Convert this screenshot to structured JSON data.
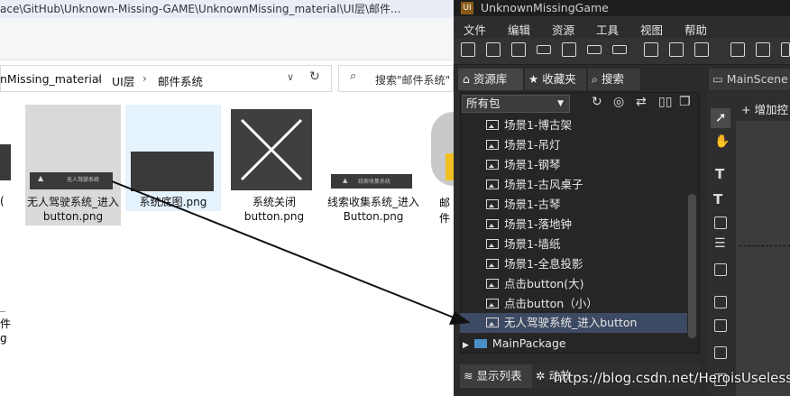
{
  "explorer": {
    "title_path": "ace\\GitHub\\Unknown-Missing-GAME\\UnknownMissing_material\\UI层\\邮件...",
    "breadcrumb": [
      "nMissing_material",
      "UI层",
      "邮件系统"
    ],
    "refresh_icon": "refresh-icon",
    "search_placeholder": "搜索\"邮件系统\"",
    "files": [
      {
        "name": "无人驾驶系统_进入button.png",
        "thumb_text": "无人驾驶系统"
      },
      {
        "name": "系统底图.png",
        "thumb_text": ""
      },
      {
        "name": "系统关闭button.png",
        "thumb_text": ""
      },
      {
        "name": "线索收集系统_进入Button.png",
        "thumb_text": "线索收集系统"
      },
      {
        "name": "邮件",
        "thumb_text": ""
      }
    ],
    "left_fragment_top": "(",
    "left_fragment_bottom_1": "件",
    "left_fragment_bottom_2": "g"
  },
  "editor": {
    "title": "UnknownMissingGame",
    "menu": [
      "文件",
      "编辑",
      "资源",
      "工具",
      "视图",
      "帮助"
    ],
    "tabs": {
      "library": "资源库",
      "favorites": "收藏夹",
      "search": "搜索"
    },
    "scene_tab": "MainScene",
    "add_button": "+ 增加控",
    "package_select": "所有包",
    "items": [
      "场景1-博古架",
      "场景1-吊灯",
      "场景1-钢琴",
      "场景1-古风桌子",
      "场景1-古琴",
      "场景1-落地钟",
      "场景1-墙纸",
      "场景1-全息投影",
      "点击button(大)",
      "点击button（小）",
      "无人驾驶系统_进入button"
    ],
    "package_row": "MainPackage",
    "bottom_tabs": {
      "display_list": "显示列表",
      "animation": "动效"
    }
  },
  "watermark": "https://blog.csdn.net/HeroisUseless",
  "colors": {
    "selection": "#3d4a63",
    "panel_bg": "#262626",
    "explorer_select": "#d9d9d9",
    "explorer_hover": "#e5f3ff"
  }
}
